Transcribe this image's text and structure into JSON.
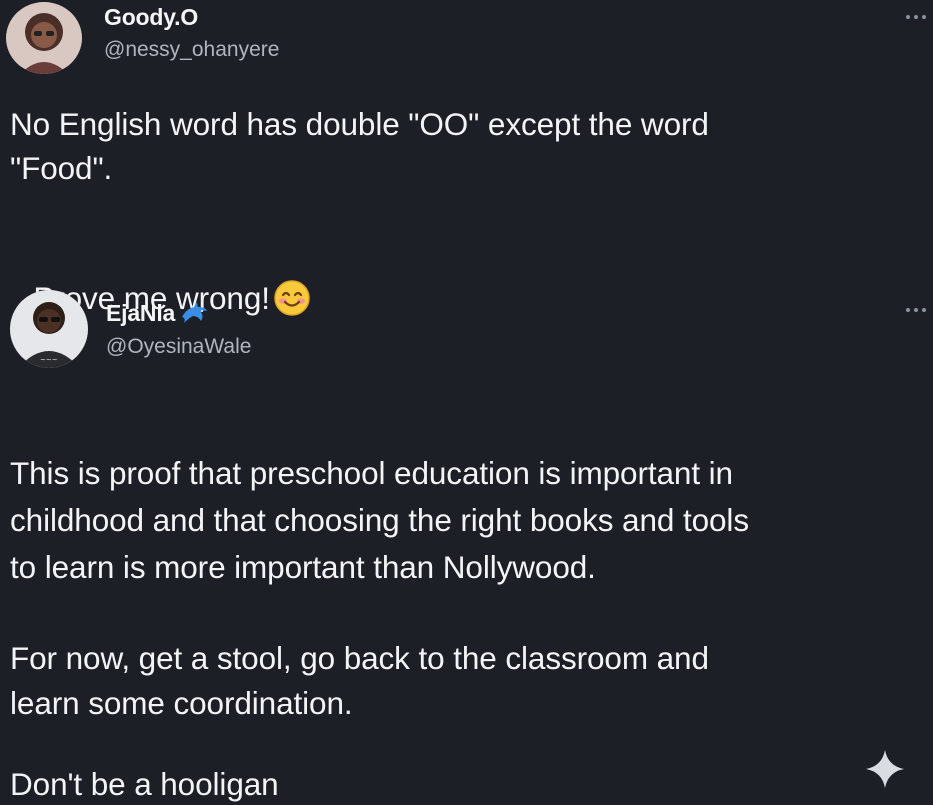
{
  "colors": {
    "background": "#1c1f26",
    "text": "#f3f4f6",
    "muted": "#b0b5bd",
    "badge": "#3a8ee6"
  },
  "original_tweet": {
    "author_name": "Goody.O",
    "author_handle": "@nessy_ohanyere",
    "line1": "No English word has double \"OO\" except the word",
    "line2": "\"Food\".",
    "line3": "Prove me wrong!",
    "emoji_icon": "smiling-face-icon"
  },
  "reply_tweet": {
    "author_name": "EjaNla",
    "author_handle": "@OyesinaWale",
    "badge_icon": "dolphin-badge-icon",
    "paragraph1": [
      "This is proof that preschool education is important in",
      "childhood and that choosing the right books and tools",
      "to learn is more important than Nollywood."
    ],
    "paragraph2": [
      "For now, get a stool, go back to the classroom and",
      "learn some coordination."
    ],
    "paragraph3": "Don't be a hooligan"
  },
  "icons": {
    "more": "more-options-icon",
    "sparkle": "sparkle-icon"
  }
}
